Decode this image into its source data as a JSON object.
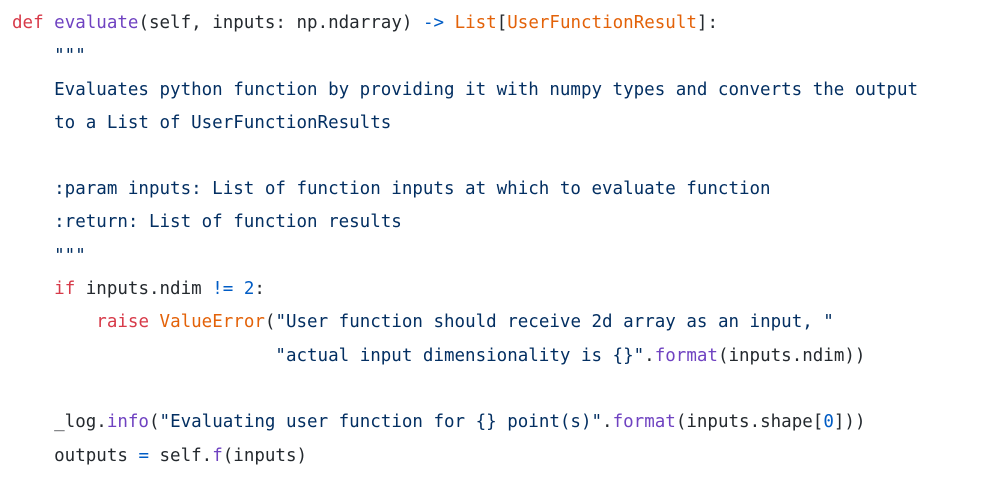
{
  "code_lines": [
    [
      {
        "text": "def",
        "color": "#d73a49"
      },
      {
        "text": " ",
        "color": "#24292e"
      },
      {
        "text": "evaluate",
        "color": "#6f42c1"
      },
      {
        "text": "(self, inputs: np.ndarray) ",
        "color": "#24292e"
      },
      {
        "text": "->",
        "color": "#005cc5"
      },
      {
        "text": " ",
        "color": "#24292e"
      },
      {
        "text": "List",
        "color": "#e36209"
      },
      {
        "text": "[",
        "color": "#24292e"
      },
      {
        "text": "UserFunctionResult",
        "color": "#e36209"
      },
      {
        "text": "]:",
        "color": "#24292e"
      }
    ],
    [
      {
        "text": "    \"\"\"",
        "color": "#032f62"
      }
    ],
    [
      {
        "text": "    Evaluates python function by providing it with numpy types and converts the output",
        "color": "#032f62"
      }
    ],
    [
      {
        "text": "    to a List of UserFunctionResults",
        "color": "#032f62"
      }
    ],
    [],
    [
      {
        "text": "    :param inputs: List of function inputs at which to evaluate function",
        "color": "#032f62"
      }
    ],
    [
      {
        "text": "    :return: List of function results",
        "color": "#032f62"
      }
    ],
    [
      {
        "text": "    \"\"\"",
        "color": "#032f62"
      }
    ],
    [
      {
        "text": "    ",
        "color": "#24292e"
      },
      {
        "text": "if",
        "color": "#d73a49"
      },
      {
        "text": " inputs.ndim ",
        "color": "#24292e"
      },
      {
        "text": "!=",
        "color": "#005cc5"
      },
      {
        "text": " ",
        "color": "#24292e"
      },
      {
        "text": "2",
        "color": "#005cc5"
      },
      {
        "text": ":",
        "color": "#24292e"
      }
    ],
    [
      {
        "text": "        ",
        "color": "#24292e"
      },
      {
        "text": "raise",
        "color": "#d73a49"
      },
      {
        "text": " ",
        "color": "#24292e"
      },
      {
        "text": "ValueError",
        "color": "#e36209"
      },
      {
        "text": "(",
        "color": "#24292e"
      },
      {
        "text": "\"User function should receive 2d array as an input, \"",
        "color": "#032f62"
      }
    ],
    [
      {
        "text": "                         ",
        "color": "#24292e"
      },
      {
        "text": "\"actual input dimensionality is {}\"",
        "color": "#032f62"
      },
      {
        "text": ".",
        "color": "#24292e"
      },
      {
        "text": "format",
        "color": "#6f42c1"
      },
      {
        "text": "(inputs.ndim))",
        "color": "#24292e"
      }
    ],
    [],
    [
      {
        "text": "    _log.",
        "color": "#24292e"
      },
      {
        "text": "info",
        "color": "#6f42c1"
      },
      {
        "text": "(",
        "color": "#24292e"
      },
      {
        "text": "\"Evaluating user function for {} point(s)\"",
        "color": "#032f62"
      },
      {
        "text": ".",
        "color": "#24292e"
      },
      {
        "text": "format",
        "color": "#6f42c1"
      },
      {
        "text": "(inputs.shape[",
        "color": "#24292e"
      },
      {
        "text": "0",
        "color": "#005cc5"
      },
      {
        "text": "]))",
        "color": "#24292e"
      }
    ],
    [
      {
        "text": "    outputs ",
        "color": "#24292e"
      },
      {
        "text": "=",
        "color": "#005cc5"
      },
      {
        "text": " self.",
        "color": "#24292e"
      },
      {
        "text": "f",
        "color": "#6f42c1"
      },
      {
        "text": "(inputs)",
        "color": "#24292e"
      }
    ]
  ]
}
